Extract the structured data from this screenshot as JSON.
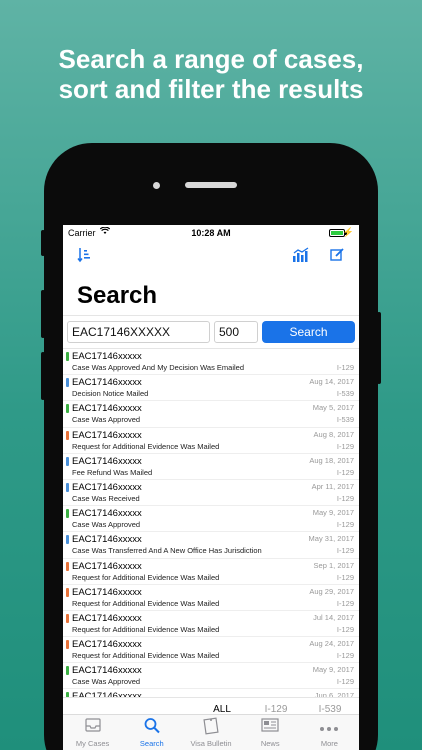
{
  "headline": {
    "line1": "Search a range of cases,",
    "line2": "sort and filter the results"
  },
  "status_bar": {
    "carrier": "Carrier",
    "time": "10:28 AM"
  },
  "nav": {
    "sort_icon": "sort-icon",
    "chart_icon": "chart-icon",
    "edit_icon": "edit-icon"
  },
  "page_title": "Search",
  "search": {
    "receipt_value": "EAC17146XXXXX",
    "count_value": "500",
    "button_label": "Search"
  },
  "status_colors": {
    "green": "#3cb043",
    "blue": "#4a90d9",
    "orange": "#e8733a"
  },
  "results": [
    {
      "receipt": "EAC17146xxxxx",
      "status": "Case Was Approved And My Decision Was Emailed",
      "date": "",
      "form": "I-129",
      "color": "#3cb043"
    },
    {
      "receipt": "EAC17146xxxxx",
      "status": "Decision Notice Mailed",
      "date": "Aug 14, 2017",
      "form": "I-539",
      "color": "#4a90d9"
    },
    {
      "receipt": "EAC17146xxxxx",
      "status": "Case Was Approved",
      "date": "May 5, 2017",
      "form": "I-539",
      "color": "#3cb043"
    },
    {
      "receipt": "EAC17146xxxxx",
      "status": "Request for Additional Evidence Was Mailed",
      "date": "Aug 8, 2017",
      "form": "I-129",
      "color": "#e8733a"
    },
    {
      "receipt": "EAC17146xxxxx",
      "status": "Fee Refund Was Mailed",
      "date": "Aug 18, 2017",
      "form": "I-129",
      "color": "#4a90d9"
    },
    {
      "receipt": "EAC17146xxxxx",
      "status": "Case Was Received",
      "date": "Apr 11, 2017",
      "form": "I-129",
      "color": "#4a90d9"
    },
    {
      "receipt": "EAC17146xxxxx",
      "status": "Case Was Approved",
      "date": "May 9, 2017",
      "form": "I-129",
      "color": "#3cb043"
    },
    {
      "receipt": "EAC17146xxxxx",
      "status": "Case Was Transferred And A New Office Has Jurisdiction",
      "date": "May 31, 2017",
      "form": "I-129",
      "color": "#4a90d9"
    },
    {
      "receipt": "EAC17146xxxxx",
      "status": "Request for Additional Evidence Was Mailed",
      "date": "Sep 1, 2017",
      "form": "I-129",
      "color": "#e8733a"
    },
    {
      "receipt": "EAC17146xxxxx",
      "status": "Request for Additional Evidence Was Mailed",
      "date": "Aug 29, 2017",
      "form": "I-129",
      "color": "#e8733a"
    },
    {
      "receipt": "EAC17146xxxxx",
      "status": "Request for Additional Evidence Was Mailed",
      "date": "Jul 14, 2017",
      "form": "I-129",
      "color": "#e8733a"
    },
    {
      "receipt": "EAC17146xxxxx",
      "status": "Request for Additional Evidence Was Mailed",
      "date": "Aug 24, 2017",
      "form": "I-129",
      "color": "#e8733a"
    },
    {
      "receipt": "EAC17146xxxxx",
      "status": "Case Was Approved",
      "date": "May 9, 2017",
      "form": "I-129",
      "color": "#3cb043"
    },
    {
      "receipt": "EAC17146xxxxx",
      "status": "",
      "date": "Jun 6, 2017",
      "form": "",
      "color": "#3cb043"
    }
  ],
  "filters": [
    "ALL",
    "I-129",
    "I-539"
  ],
  "active_filter": "ALL",
  "tabs": [
    {
      "label": "My Cases",
      "icon": "inbox-icon"
    },
    {
      "label": "Search",
      "icon": "search-icon"
    },
    {
      "label": "Visa Bulletin",
      "icon": "bulletin-icon"
    },
    {
      "label": "News",
      "icon": "news-icon"
    },
    {
      "label": "More",
      "icon": "more-icon"
    }
  ],
  "active_tab": "Search"
}
